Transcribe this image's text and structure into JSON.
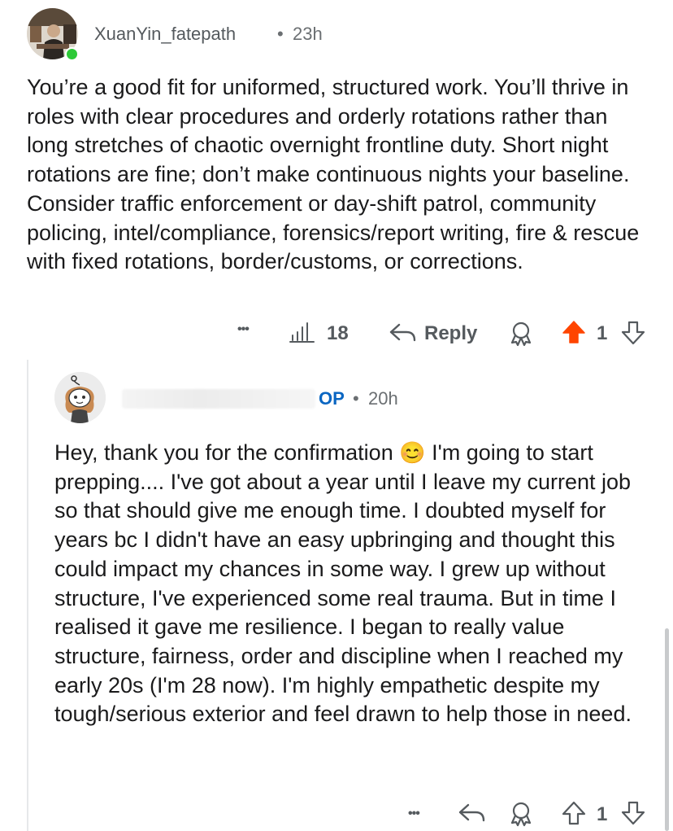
{
  "comment": {
    "username": "XuanYin_fatepath",
    "time": "23h",
    "text": "You’re a good fit for uniformed, structured work. You’ll thrive in roles with clear procedures and orderly rotations rather than long stretches of chaotic overnight frontline duty. Short night rotations are fine; don’t make continuous nights your baseline. Consider traffic enforcement or day-shift patrol, community policing, intel/compliance, forensics/report writing, fire & rescue with fixed rotations, border/customs, or corrections.",
    "more": "•••",
    "insights_count": "18",
    "reply_label": "Reply",
    "vote_count": "1",
    "upvote_color": "#ff4500",
    "icons": [
      "more-icon",
      "insights-icon",
      "reply-icon",
      "award-icon",
      "upvote-icon",
      "downvote-icon"
    ]
  },
  "reply": {
    "badge": "OP",
    "time": "20h",
    "text_before_emoji": "Hey, thank you for the confirmation",
    "emoji": "😊",
    "text_after_emoji": "I'm going to start prepping.... I've got about a year until I leave my current job so that should give me enough time. I doubted myself for years bc I didn't have an easy upbringing and thought this could impact my chances in some way. I grew up without structure, I've experienced some real trauma. But in time I realised it gave me resilience. I began to really value structure, fairness, order and discipline when I reached my early 20s (I'm 28 now). I'm highly empathetic despite my tough/serious exterior and feel drawn to help those in need.",
    "more": "•••",
    "vote_count": "1",
    "icons": [
      "more-icon",
      "reply-icon",
      "award-icon",
      "upvote-icon",
      "downvote-icon"
    ]
  },
  "separator": "•"
}
